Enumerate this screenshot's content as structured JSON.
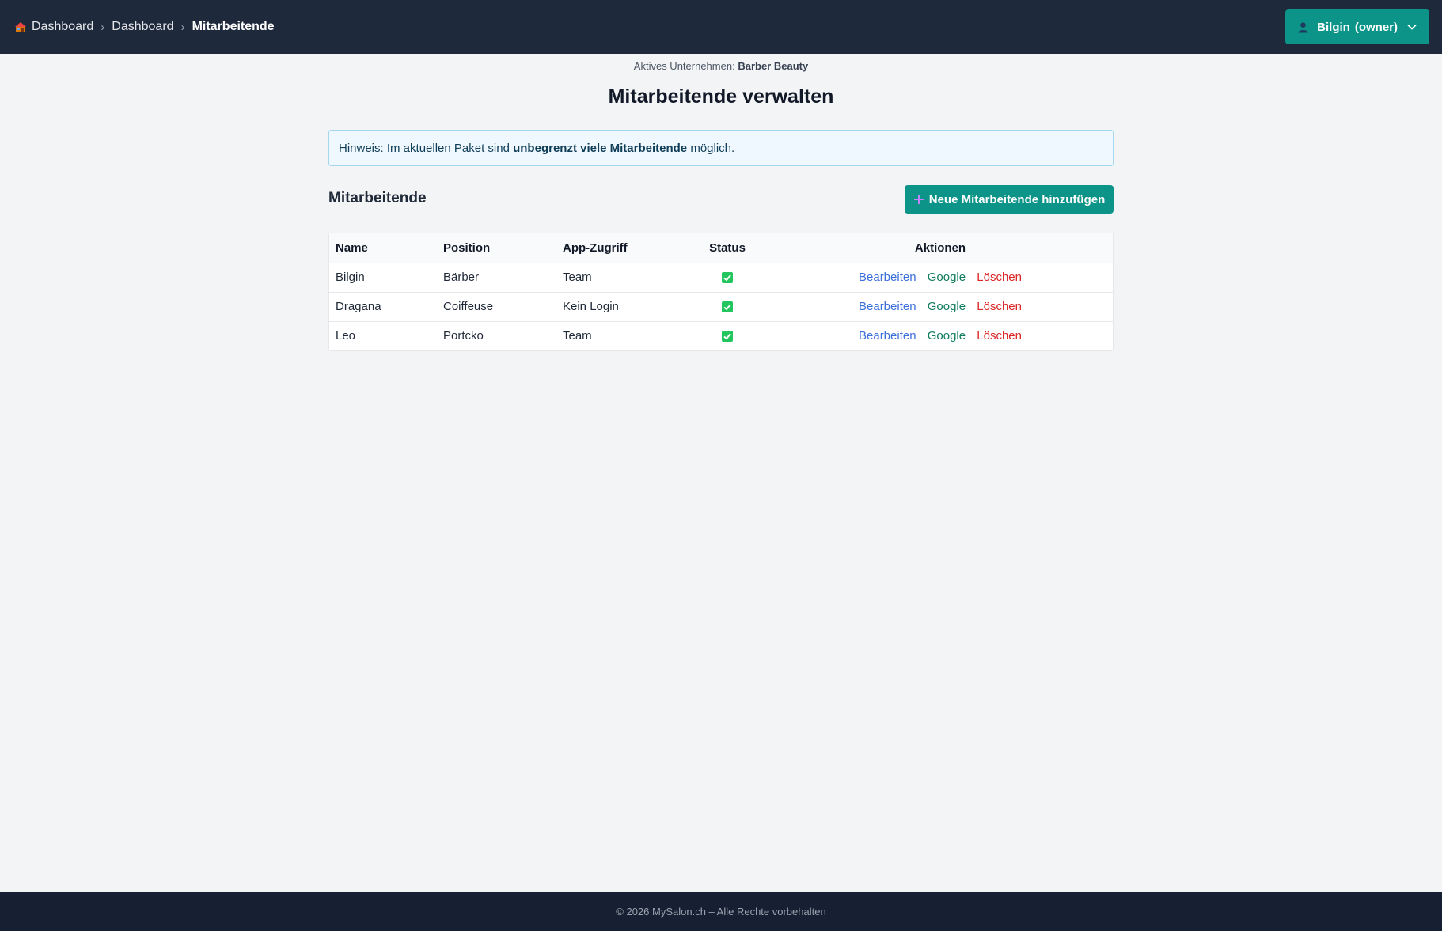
{
  "header": {
    "breadcrumb": [
      {
        "label": "Dashboard"
      },
      {
        "label": "Dashboard"
      },
      {
        "label": "Mitarbeitende"
      }
    ],
    "user": {
      "name": "Bilgin",
      "role": "(owner)"
    }
  },
  "company": {
    "label": "Aktives Unternehmen:",
    "name": "Barber Beauty"
  },
  "page_title": "Mitarbeitende verwalten",
  "notice": {
    "prefix": "Hinweis: Im aktuellen Paket sind",
    "highlight": "unbegrenzt viele Mitarbeitende",
    "suffix": "möglich."
  },
  "section": {
    "title": "Mitarbeitende",
    "add_button": "Neue Mitarbeitende hinzufügen"
  },
  "table": {
    "headers": {
      "name": "Name",
      "position": "Position",
      "app": "App-Zugriff",
      "status": "Status",
      "actions": "Aktionen"
    },
    "rows": [
      {
        "name": "Bilgin",
        "position": "Bärber",
        "app": "Team",
        "active": true
      },
      {
        "name": "Dragana",
        "position": "Coiffeuse",
        "app": "Kein Login",
        "active": true
      },
      {
        "name": "Leo",
        "position": "Portcko",
        "app": "Team",
        "active": true
      }
    ],
    "actions": {
      "edit": "Bearbeiten",
      "google": "Google",
      "delete": "Löschen"
    }
  },
  "footer": "© 2026 MySalon.ch – Alle Rechte vorbehalten",
  "colors": {
    "topbar": "#1e293b",
    "accent": "#0d9488",
    "edit": "#3b6fd9",
    "google": "#0f7a5c",
    "delete": "#dc2626",
    "status_ok": "#22c55e"
  }
}
